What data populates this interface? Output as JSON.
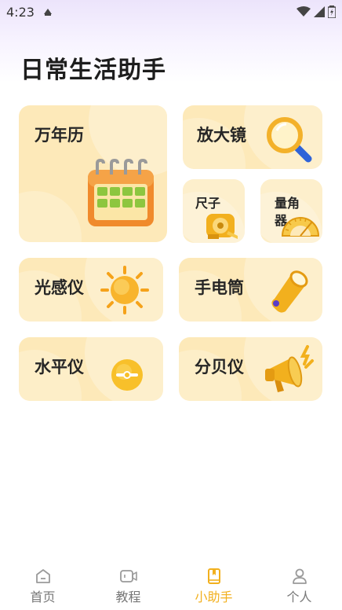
{
  "status_bar": {
    "time": "4:23"
  },
  "page": {
    "title": "日常生活助手"
  },
  "tools": {
    "calendar": {
      "label": "万年历",
      "icon": "calendar-icon"
    },
    "magnifier": {
      "label": "放大镜",
      "icon": "magnifier-icon"
    },
    "ruler": {
      "label": "尺子",
      "icon": "tape-measure-icon"
    },
    "protractor": {
      "label": "量角器",
      "icon": "protractor-icon"
    },
    "light_sensor": {
      "label": "光感仪",
      "icon": "sun-icon"
    },
    "flashlight": {
      "label": "手电筒",
      "icon": "flashlight-icon"
    },
    "level": {
      "label": "水平仪",
      "icon": "level-icon"
    },
    "decibel": {
      "label": "分贝仪",
      "icon": "megaphone-icon"
    }
  },
  "nav": {
    "items": [
      {
        "label": "首页",
        "icon": "home-icon",
        "active": false
      },
      {
        "label": "教程",
        "icon": "video-icon",
        "active": false
      },
      {
        "label": "小助手",
        "icon": "book-icon",
        "active": true
      },
      {
        "label": "个人",
        "icon": "person-icon",
        "active": false
      }
    ]
  },
  "colors": {
    "card_bg": "#fde9b9",
    "accent": "#f2b01e",
    "title": "#1d1d1d",
    "nav_inactive": "#777777"
  }
}
